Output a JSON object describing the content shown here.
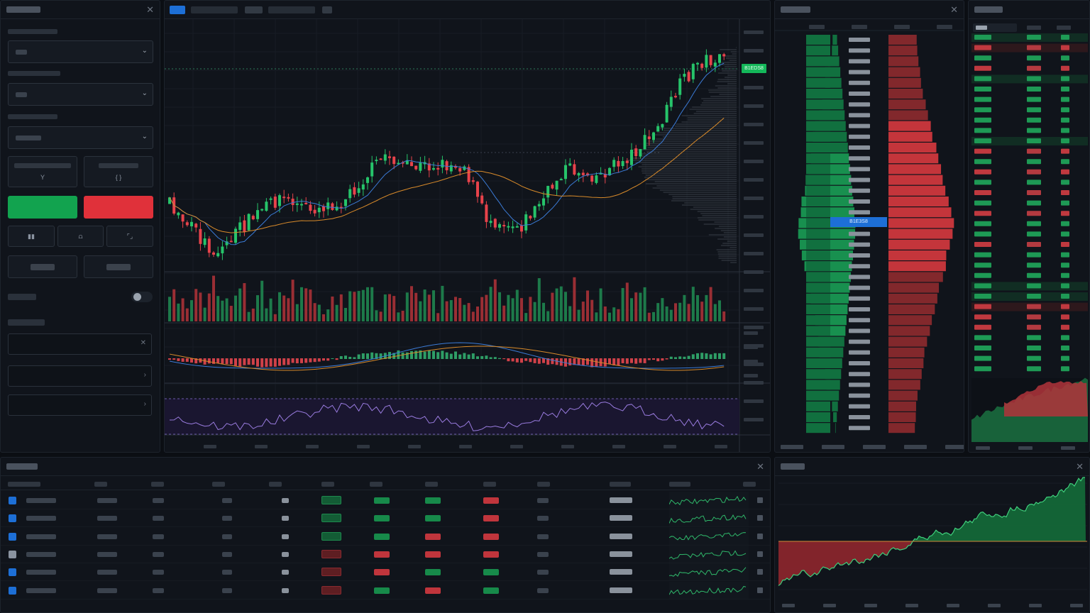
{
  "chart_panel": {
    "price_tag": "B1EDS8",
    "dom_price_tag": "B1E3S8"
  },
  "order_panel": {
    "reset_label": "Y",
    "sync_label": "{ }",
    "close_icon": "close-icon"
  },
  "colors": {
    "up": "#26c46a",
    "down": "#e8434b",
    "accent": "#1d6fd6",
    "background": "#0b0e13",
    "panel": "#10141b"
  },
  "icons": [
    "close-icon",
    "chevron-down-icon",
    "grid-icon",
    "bracket-icon"
  ]
}
